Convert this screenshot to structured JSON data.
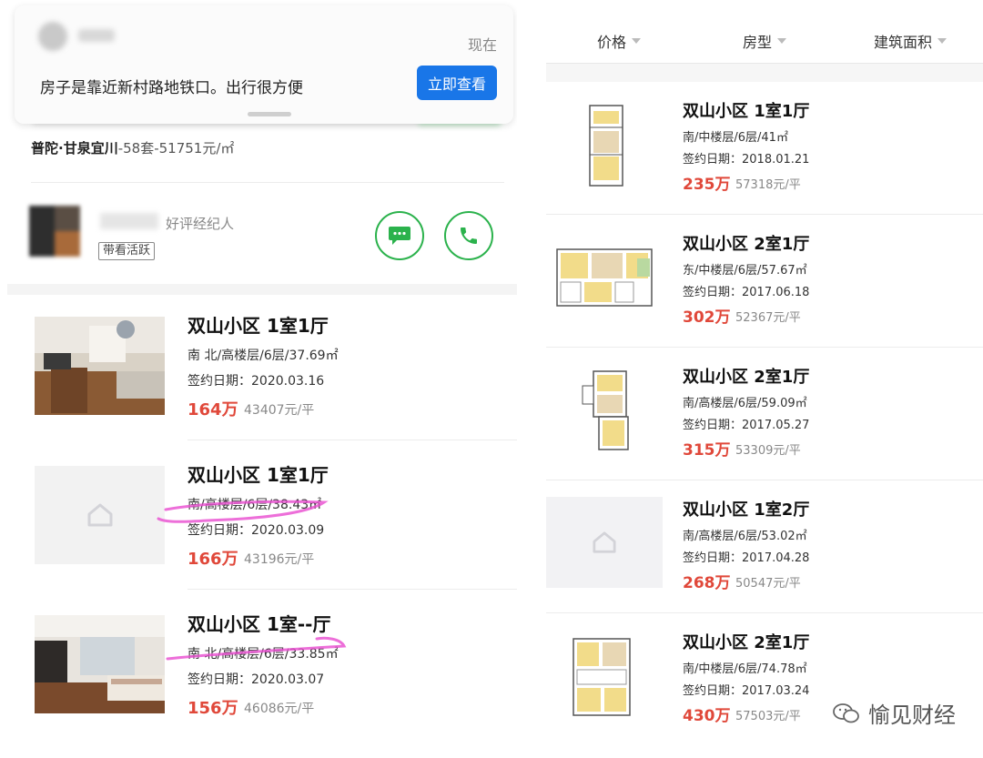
{
  "notification": {
    "time": "现在",
    "message": "房子是靠近新村路地铁口。出行很方便",
    "button": "立即查看"
  },
  "community": {
    "district": "普陀·甘泉宜川",
    "stats": "-58套-51751元/㎡"
  },
  "agent": {
    "tag": "好评经纪人",
    "badge": "带看活跃",
    "actions": [
      "chat-icon",
      "phone-icon"
    ]
  },
  "left_listings": [
    {
      "title": "双山小区 1室1厅",
      "info": "南 北/高楼层/6层/37.69㎡",
      "date": "签约日期：2020.03.16",
      "price": "164万",
      "unit": "43407元/平"
    },
    {
      "title": "双山小区 1室1厅",
      "info": "南/高楼层/6层/38.43㎡",
      "date": "签约日期：2020.03.09",
      "price": "166万",
      "unit": "43196元/平"
    },
    {
      "title": "双山小区 1室--厅",
      "info": "南 北/高楼层/6层/33.85㎡",
      "date": "签约日期：2020.03.07",
      "price": "156万",
      "unit": "46086元/平"
    }
  ],
  "filters": [
    "价格",
    "房型",
    "建筑面积"
  ],
  "right_listings": [
    {
      "title": "双山小区 1室1厅",
      "info": "南/中楼层/6层/41㎡",
      "date": "签约日期：2018.01.21",
      "price": "235万",
      "unit": "57318元/平"
    },
    {
      "title": "双山小区 2室1厅",
      "info": "东/中楼层/6层/57.67㎡",
      "date": "签约日期：2017.06.18",
      "price": "302万",
      "unit": "52367元/平"
    },
    {
      "title": "双山小区 2室1厅",
      "info": "南/高楼层/6层/59.09㎡",
      "date": "签约日期：2017.05.27",
      "price": "315万",
      "unit": "53309元/平"
    },
    {
      "title": "双山小区 1室2厅",
      "info": "南/高楼层/6层/53.02㎡",
      "date": "签约日期：2017.04.28",
      "price": "268万",
      "unit": "50547元/平"
    },
    {
      "title": "双山小区 2室1厅",
      "info": "南/中楼层/6层/74.78㎡",
      "date": "签约日期：2017.03.24",
      "price": "430万",
      "unit": "57503元/平"
    }
  ],
  "watermark": "愉见财经",
  "colors": {
    "accent_blue": "#1976e8",
    "price_red": "#e0483a",
    "wechat_green": "#2bb24c",
    "highlight_pink": "#e94bd0"
  }
}
